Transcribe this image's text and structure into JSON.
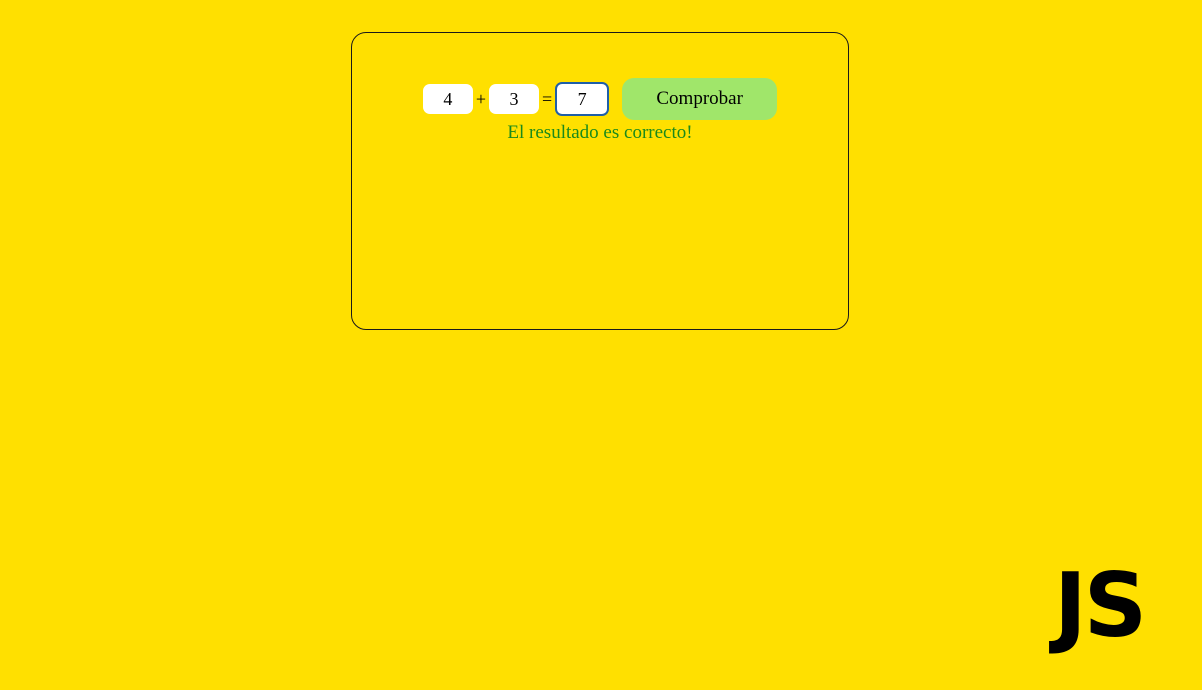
{
  "quiz": {
    "operand_a": "4",
    "operator": "+",
    "operand_b": "3",
    "equals": "=",
    "answer": "7",
    "check_label": "Comprobar",
    "result_message": "El resultado es correcto!"
  },
  "logo": {
    "text": "JS"
  },
  "colors": {
    "background": "#ffe000",
    "button": "#a0e66a",
    "success_text": "#1b8a1b",
    "focus_border": "#1f5fa8"
  }
}
